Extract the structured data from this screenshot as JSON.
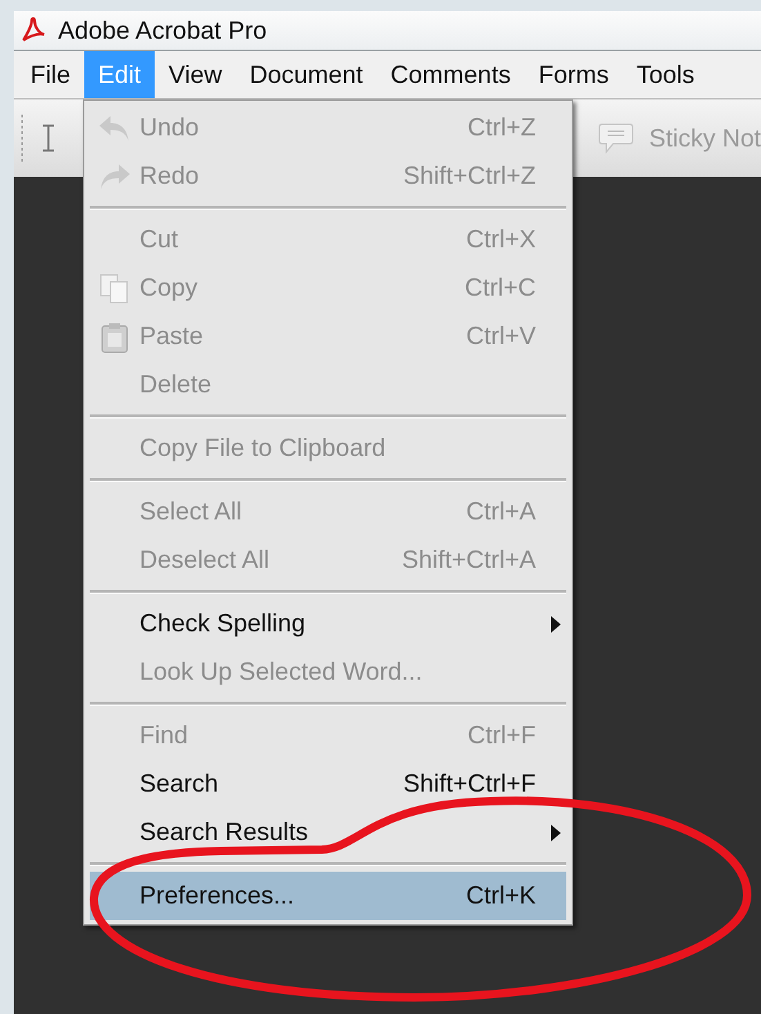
{
  "window": {
    "title": "Adobe Acrobat Pro"
  },
  "menubar": [
    {
      "label": "File",
      "selected": false
    },
    {
      "label": "Edit",
      "selected": true
    },
    {
      "label": "View",
      "selected": false
    },
    {
      "label": "Document",
      "selected": false
    },
    {
      "label": "Comments",
      "selected": false
    },
    {
      "label": "Forms",
      "selected": false
    },
    {
      "label": "Tools",
      "selected": false
    }
  ],
  "toolbar": {
    "sticky_note": "Sticky Not"
  },
  "edit_menu": [
    {
      "kind": "item",
      "label": "Undo",
      "shortcut": "Ctrl+Z",
      "disabled": true,
      "icon": true,
      "submenu": false,
      "selected": false
    },
    {
      "kind": "item",
      "label": "Redo",
      "shortcut": "Shift+Ctrl+Z",
      "disabled": true,
      "icon": true,
      "submenu": false,
      "selected": false
    },
    {
      "kind": "separator"
    },
    {
      "kind": "item",
      "label": "Cut",
      "shortcut": "Ctrl+X",
      "disabled": true,
      "icon": false,
      "submenu": false,
      "selected": false
    },
    {
      "kind": "item",
      "label": "Copy",
      "shortcut": "Ctrl+C",
      "disabled": true,
      "icon": true,
      "submenu": false,
      "selected": false
    },
    {
      "kind": "item",
      "label": "Paste",
      "shortcut": "Ctrl+V",
      "disabled": true,
      "icon": true,
      "submenu": false,
      "selected": false
    },
    {
      "kind": "item",
      "label": "Delete",
      "disabled": true,
      "icon": false,
      "submenu": false,
      "selected": false
    },
    {
      "kind": "separator"
    },
    {
      "kind": "item",
      "label": "Copy File to Clipboard",
      "disabled": true,
      "icon": false,
      "submenu": false,
      "selected": false
    },
    {
      "kind": "separator"
    },
    {
      "kind": "item",
      "label": "Select All",
      "shortcut": "Ctrl+A",
      "disabled": true,
      "icon": false,
      "submenu": false,
      "selected": false
    },
    {
      "kind": "item",
      "label": "Deselect All",
      "shortcut": "Shift+Ctrl+A",
      "disabled": true,
      "icon": false,
      "submenu": false,
      "selected": false
    },
    {
      "kind": "separator"
    },
    {
      "kind": "item",
      "label": "Check Spelling",
      "disabled": false,
      "icon": false,
      "submenu": true,
      "selected": false
    },
    {
      "kind": "item",
      "label": "Look Up Selected Word...",
      "disabled": true,
      "icon": false,
      "submenu": false,
      "selected": false
    },
    {
      "kind": "separator"
    },
    {
      "kind": "item",
      "label": "Find",
      "shortcut": "Ctrl+F",
      "disabled": true,
      "icon": false,
      "submenu": false,
      "selected": false
    },
    {
      "kind": "item",
      "label": "Search",
      "shortcut": "Shift+Ctrl+F",
      "disabled": false,
      "icon": false,
      "submenu": false,
      "selected": false
    },
    {
      "kind": "item",
      "label": "Search Results",
      "disabled": false,
      "icon": false,
      "submenu": true,
      "selected": false
    },
    {
      "kind": "separator"
    },
    {
      "kind": "item",
      "label": "Preferences...",
      "shortcut": "Ctrl+K",
      "disabled": false,
      "icon": false,
      "submenu": false,
      "selected": true
    }
  ]
}
